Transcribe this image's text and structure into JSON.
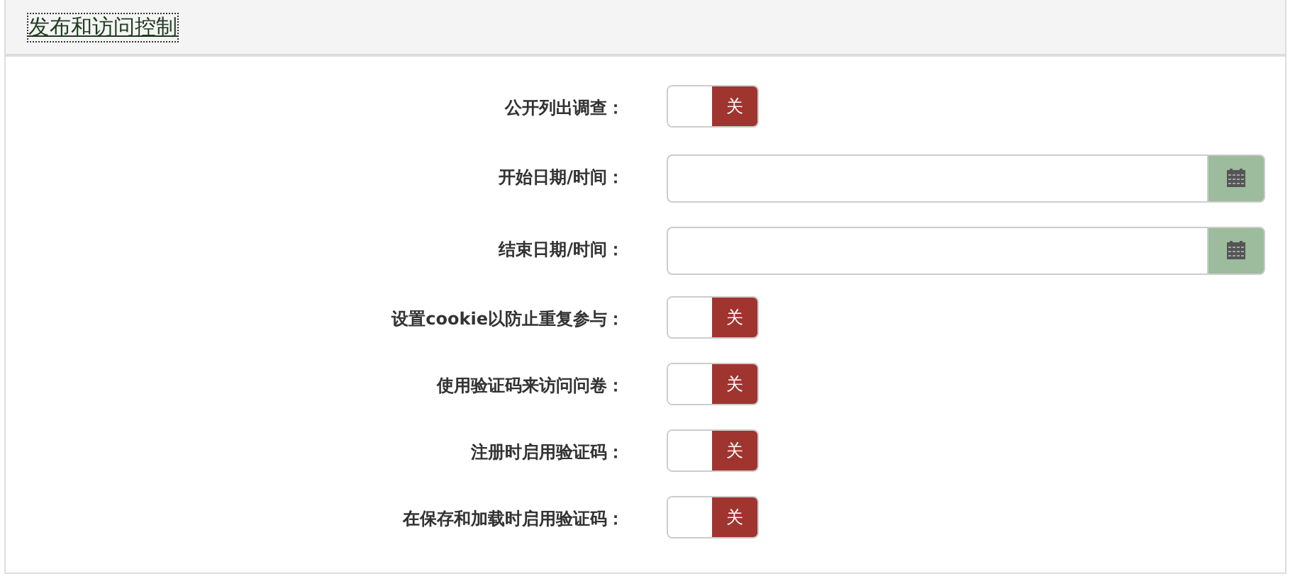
{
  "panel": {
    "title": "发布和访问控制"
  },
  "fields": [
    {
      "kind": "toggle",
      "label": "公开列出调查：",
      "on": false,
      "state_text": "关"
    },
    {
      "kind": "datetime",
      "label": "开始日期/时间："
    },
    {
      "kind": "datetime",
      "label": "结束日期/时间："
    },
    {
      "kind": "toggle",
      "label": "设置cookie以防止重复参与：",
      "on": false,
      "state_text": "关"
    },
    {
      "kind": "toggle",
      "label": "使用验证码来访问问卷：",
      "on": false,
      "state_text": "关"
    },
    {
      "kind": "toggle",
      "label": "注册时启用验证码：",
      "on": false,
      "state_text": "关"
    },
    {
      "kind": "toggle",
      "label": "在保存和加载时启用验证码：",
      "on": false,
      "state_text": "关"
    }
  ]
}
